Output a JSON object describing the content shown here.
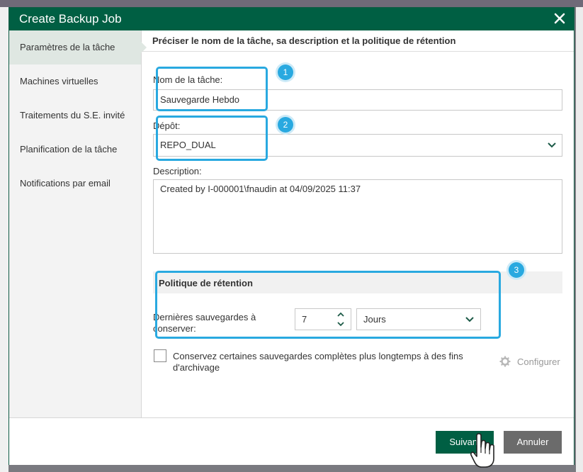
{
  "dialog": {
    "title": "Create Backup Job",
    "close_icon": "close-icon"
  },
  "sidebar": {
    "items": [
      {
        "label": "Paramètres de la tâche",
        "active": true
      },
      {
        "label": "Machines virtuelles"
      },
      {
        "label": "Traitements du S.E. invité"
      },
      {
        "label": "Planification de la tâche"
      },
      {
        "label": "Notifications par email"
      }
    ]
  },
  "main": {
    "header": "Préciser le nom de la tâche, sa description et la politique de rétention",
    "job_name": {
      "label": "Nom de la tâche:",
      "value": "Sauvegarde Hebdo"
    },
    "repository": {
      "label": "Dépôt:",
      "value": "REPO_DUAL"
    },
    "description": {
      "label": "Description:",
      "value": "Created by I-000001\\fnaudin at 04/09/2025 11:37"
    },
    "retention": {
      "heading": "Politique de rétention",
      "keep_label": "Dernières sauvegardes à conserver:",
      "count": "7",
      "unit": "Jours"
    },
    "archive": {
      "checkbox_label": "Conservez certaines sauvegardes complètes plus longtemps à des fins d'archivage",
      "configure_label": "Configurer",
      "checked": false
    },
    "callouts": [
      "1",
      "2",
      "3"
    ]
  },
  "footer": {
    "next_label": "Suivant",
    "cancel_label": "Annuler"
  },
  "colors": {
    "brand": "#005f43",
    "callout": "#29a9e0",
    "cancel": "#6b6b6b"
  }
}
